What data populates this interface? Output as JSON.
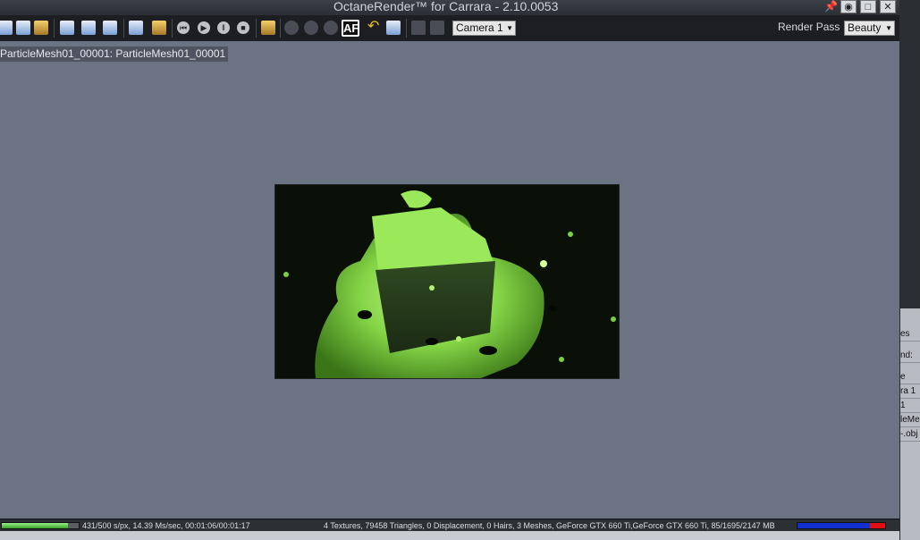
{
  "window": {
    "title": "OctaneRender™ for Carrara - 2.10.0053",
    "pin_icon": "pin-icon",
    "buttons": [
      "eye-icon",
      "maximize-icon",
      "close-icon"
    ]
  },
  "toolbar": {
    "af_label": "AF",
    "camera_select": "Camera 1",
    "render_pass_label": "Render Pass",
    "render_pass_select": "Beauty"
  },
  "viewport": {
    "object_label": "ParticleMesh01_00001: ParticleMesh01_00001"
  },
  "right_panel": {
    "rows": [
      "es",
      "nd:",
      "e",
      "ra 1",
      "1",
      "leMe",
      "-.obj"
    ]
  },
  "status": {
    "progress_fraction": 0.862,
    "left_text": "431/500 s/px, 14.39 Ms/sec, 00:01:06/00:01:17",
    "right_text": "4 Textures, 79458 Triangles, 0 Displacement, 0 Hairs, 3 Meshes, GeForce GTX 660 Ti,GeForce GTX 660 Ti, 85/1695/2147 MB",
    "memory_used_fraction": 0.17
  },
  "colors": {
    "viewport_bg": "#6b7385",
    "render_green": "#8be04a",
    "memory_free": "#1030d0",
    "memory_used": "#e01010"
  }
}
